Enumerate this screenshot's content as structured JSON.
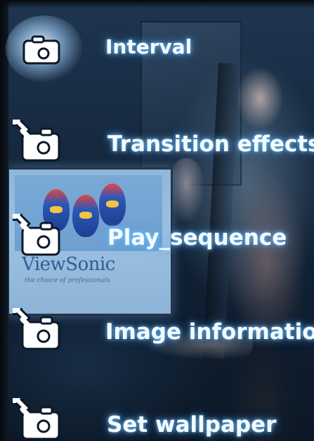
{
  "colors": {
    "label_text": "#f4fbff",
    "label_glow": "#50aaff",
    "icon_fill": "#ffffff",
    "icon_outline": "#0a1828"
  },
  "background_photo": {
    "brand_text": "ViewSonic",
    "tagline": "the choice of professionals"
  },
  "menu": {
    "selected_index": 0,
    "items": [
      {
        "label": "Interval",
        "icon": "camera-icon"
      },
      {
        "label": "Transition effects",
        "icon": "wrench-camera-icon"
      },
      {
        "label": "Play_sequence",
        "icon": "wrench-camera-icon"
      },
      {
        "label": "Image information",
        "icon": "wrench-camera-icon"
      },
      {
        "label": "Set wallpaper",
        "icon": "wrench-camera-icon"
      }
    ]
  }
}
